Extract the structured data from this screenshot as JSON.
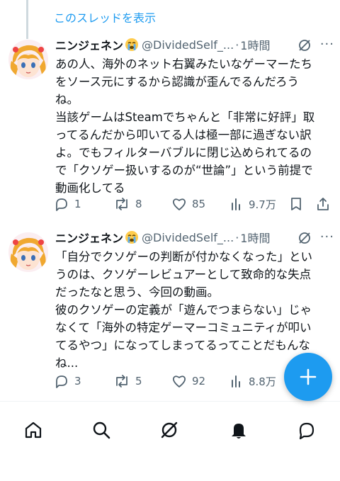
{
  "thread": {
    "show_thread_label": "このスレッドを表示"
  },
  "tweets": [
    {
      "author_name": "ニンジェネン",
      "author_emoji": "crying-face-emoji",
      "handle": "@DividedSelf_...",
      "dot": "·",
      "time": "1時間",
      "more": "···",
      "lines": [
        "あの人、海外のネット右翼みたいなゲーマーたち",
        "をソース元にするから認識が歪んでるんだろう",
        "ね。",
        "当該ゲームはSteamでちゃんと「非常に好評」取",
        "ってるんだから叩いてる人は極一部に過ぎない訳",
        "よ。でもフィルターバブルに閉じ込められてるの",
        "で「クソゲー扱いするのが“世論”」という前提で",
        "動画化してる"
      ],
      "replies": "1",
      "retweets": "8",
      "likes": "85",
      "views": "9.7万"
    },
    {
      "author_name": "ニンジェネン",
      "author_emoji": "crying-face-emoji",
      "handle": "@DividedSelf_...",
      "dot": "·",
      "time": "1時間",
      "more": "···",
      "lines": [
        "「自分でクソゲーの判断が付かなくなった」とい",
        "うのは、クソゲーレビュアーとして致命的な失点",
        "だったなと思う、今回の動画。",
        "彼のクソゲーの定義が「遊んでつまらない」じゃ",
        "なくて「海外の特定ゲーマーコミュニティが叩い",
        "てるやつ」になってしまってるってことだもんな",
        "ね..."
      ],
      "replies": "3",
      "retweets": "5",
      "likes": "92",
      "views": "8.8万"
    }
  ],
  "colors": {
    "accent": "#1d9bf0",
    "text": "#0f1419",
    "secondary": "#536471",
    "thread_line": "#cfd9de"
  },
  "fab": {
    "icon": "plus-icon"
  },
  "bottom_nav": [
    "home-icon",
    "search-icon",
    "grok-icon",
    "notifications-bell-icon",
    "messages-icon"
  ]
}
